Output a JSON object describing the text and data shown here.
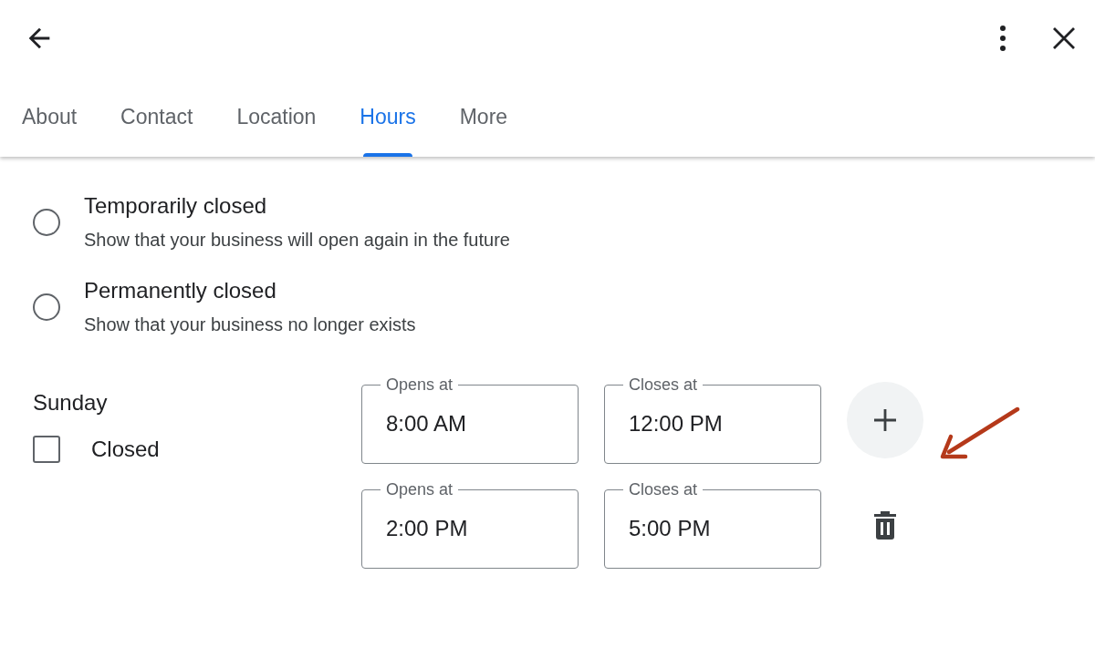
{
  "tabs": [
    {
      "label": "About",
      "selected": false
    },
    {
      "label": "Contact",
      "selected": false
    },
    {
      "label": "Location",
      "selected": false
    },
    {
      "label": "Hours",
      "selected": true
    },
    {
      "label": "More",
      "selected": false
    }
  ],
  "status_options": [
    {
      "title": "Temporarily closed",
      "description": "Show that your business will open again in the future",
      "selected": false
    },
    {
      "title": "Permanently closed",
      "description": "Show that your business no longer exists",
      "selected": false
    }
  ],
  "day": {
    "name": "Sunday",
    "closed_label": "Closed",
    "closed": false,
    "slots": [
      {
        "opens_label": "Opens at",
        "opens": "8:00 AM",
        "closes_label": "Closes at",
        "closes": "12:00 PM",
        "kind": "add"
      },
      {
        "opens_label": "Opens at",
        "opens": "2:00 PM",
        "closes_label": "Closes at",
        "closes": "5:00 PM",
        "kind": "delete"
      }
    ]
  }
}
